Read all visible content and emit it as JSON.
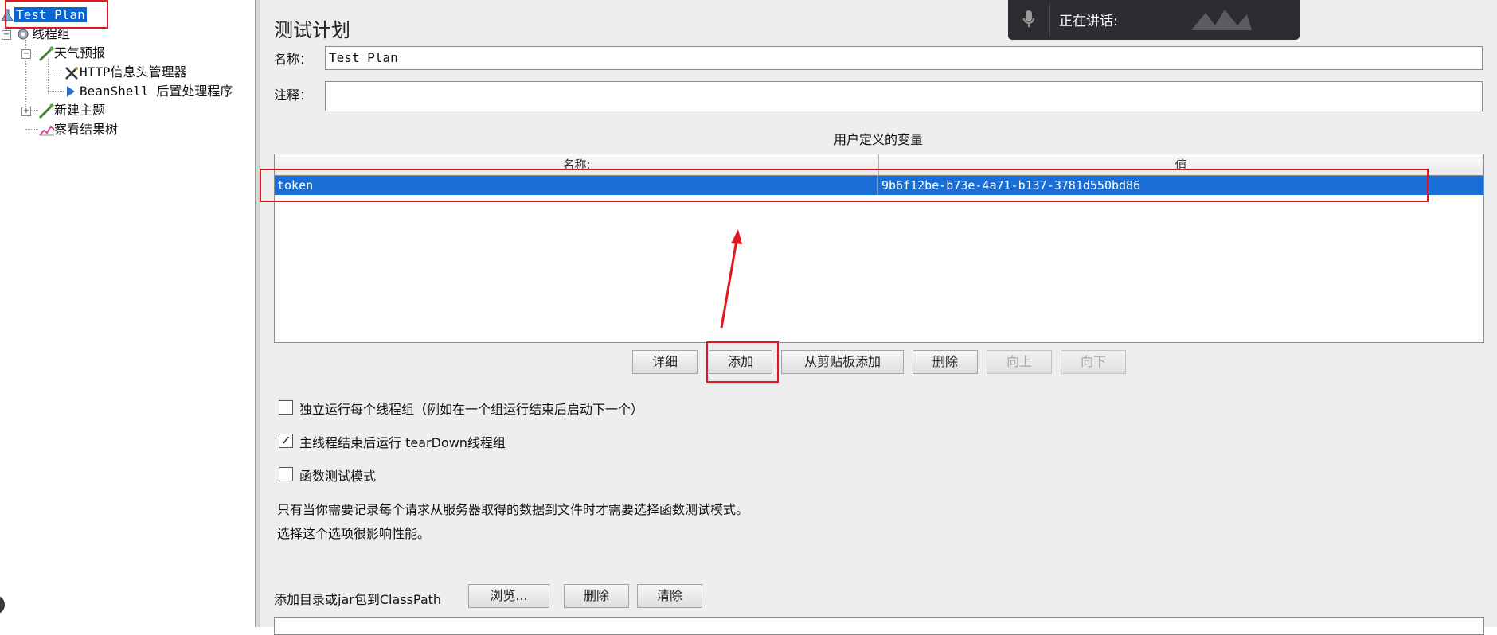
{
  "tree": {
    "items": [
      {
        "label": "Test Plan",
        "icon": "flask-icon"
      },
      {
        "label": "线程组",
        "icon": "gear-icon"
      },
      {
        "label": "天气预报",
        "icon": "pipette-icon"
      },
      {
        "label": "HTTP信息头管理器",
        "icon": "wrench-icon"
      },
      {
        "label": "BeanShell 后置处理程序",
        "icon": "arrow-icon"
      },
      {
        "label": "新建主题",
        "icon": "pipette-icon"
      },
      {
        "label": "察看结果树",
        "icon": "chart-icon"
      }
    ]
  },
  "panel": {
    "title": "测试计划",
    "name_label": "名称：",
    "name_value": "Test Plan",
    "comment_label": "注释：",
    "comment_value": "",
    "variables_caption": "用户定义的变量",
    "table": {
      "headers": [
        "名称:",
        "值"
      ],
      "rows": [
        {
          "name": "token",
          "value": "9b6f12be-b73e-4a71-b137-3781d550bd86"
        }
      ]
    },
    "buttons": {
      "detail": "详细",
      "add": "添加",
      "add_from_clipboard": "从剪贴板添加",
      "delete": "删除",
      "up": "向上",
      "down": "向下"
    },
    "options": [
      {
        "label": "独立运行每个线程组（例如在一个组运行结束后启动下一个）",
        "checked": false
      },
      {
        "label": "主线程结束后运行 tearDown线程组",
        "checked": true
      },
      {
        "label": "函数测试模式",
        "checked": false
      }
    ],
    "note_line1": "只有当你需要记录每个请求从服务器取得的数据到文件时才需要选择函数测试模式。",
    "note_line2": "选择这个选项很影响性能。",
    "classpath_label": "添加目录或jar包到ClassPath",
    "classpath_buttons": {
      "browse": "浏览...",
      "delete": "删除",
      "clear": "清除"
    }
  },
  "speaking": {
    "label": "正在讲话:"
  },
  "colors": {
    "selection": "#1a6fd6",
    "annotation": "#e4161d",
    "panel_bg": "#eeeeee"
  }
}
